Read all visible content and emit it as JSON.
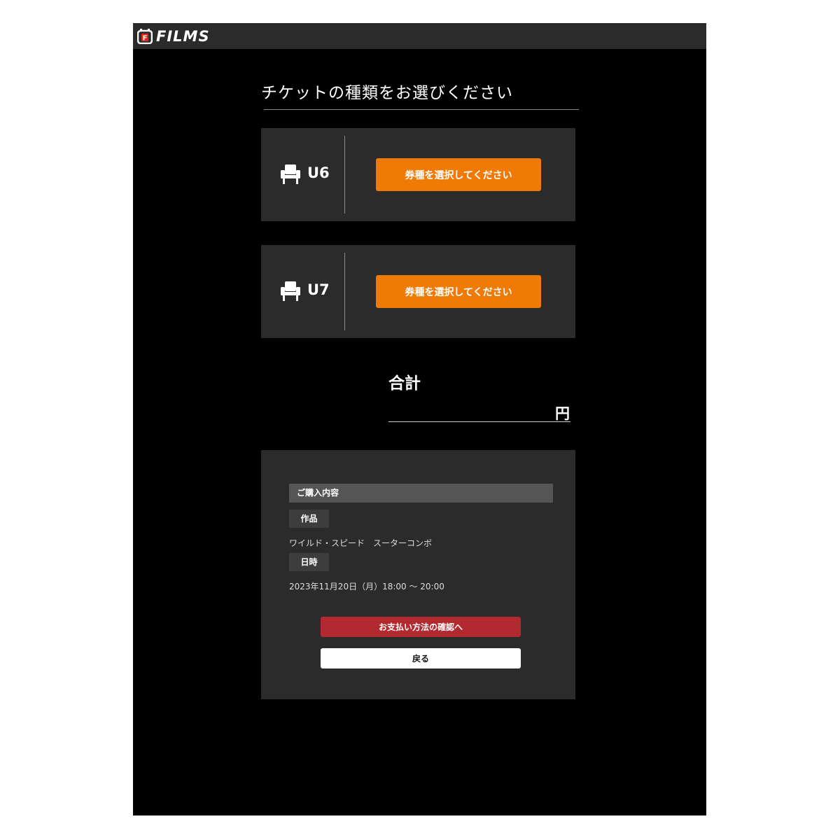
{
  "header": {
    "logo_text": "FILMS",
    "logo_mark_letter": "F",
    "logo_accent": "#e0231b"
  },
  "page": {
    "title": "チケットの種類をお選びください"
  },
  "seats": [
    {
      "icon": "seat-icon",
      "label": "U6",
      "button_label": "券種を選択してください"
    },
    {
      "icon": "seat-icon",
      "label": "U7",
      "button_label": "券種を選択してください"
    }
  ],
  "total": {
    "label": "合計",
    "amount": "",
    "unit": "円"
  },
  "summary": {
    "header": "ご購入内容",
    "work_label": "作品",
    "work_value": "ワイルド・スピード　スーターコンボ",
    "datetime_label": "日時",
    "datetime_value": "2023年11月20日（月）18:00 〜 20:00",
    "pay_button": "お支払い方法の確認へ",
    "back_button": "戻る"
  },
  "colors": {
    "background": "#000000",
    "card": "#2b2b2b",
    "select_button": "#ef7a05",
    "pay_button": "#b22a2f"
  }
}
